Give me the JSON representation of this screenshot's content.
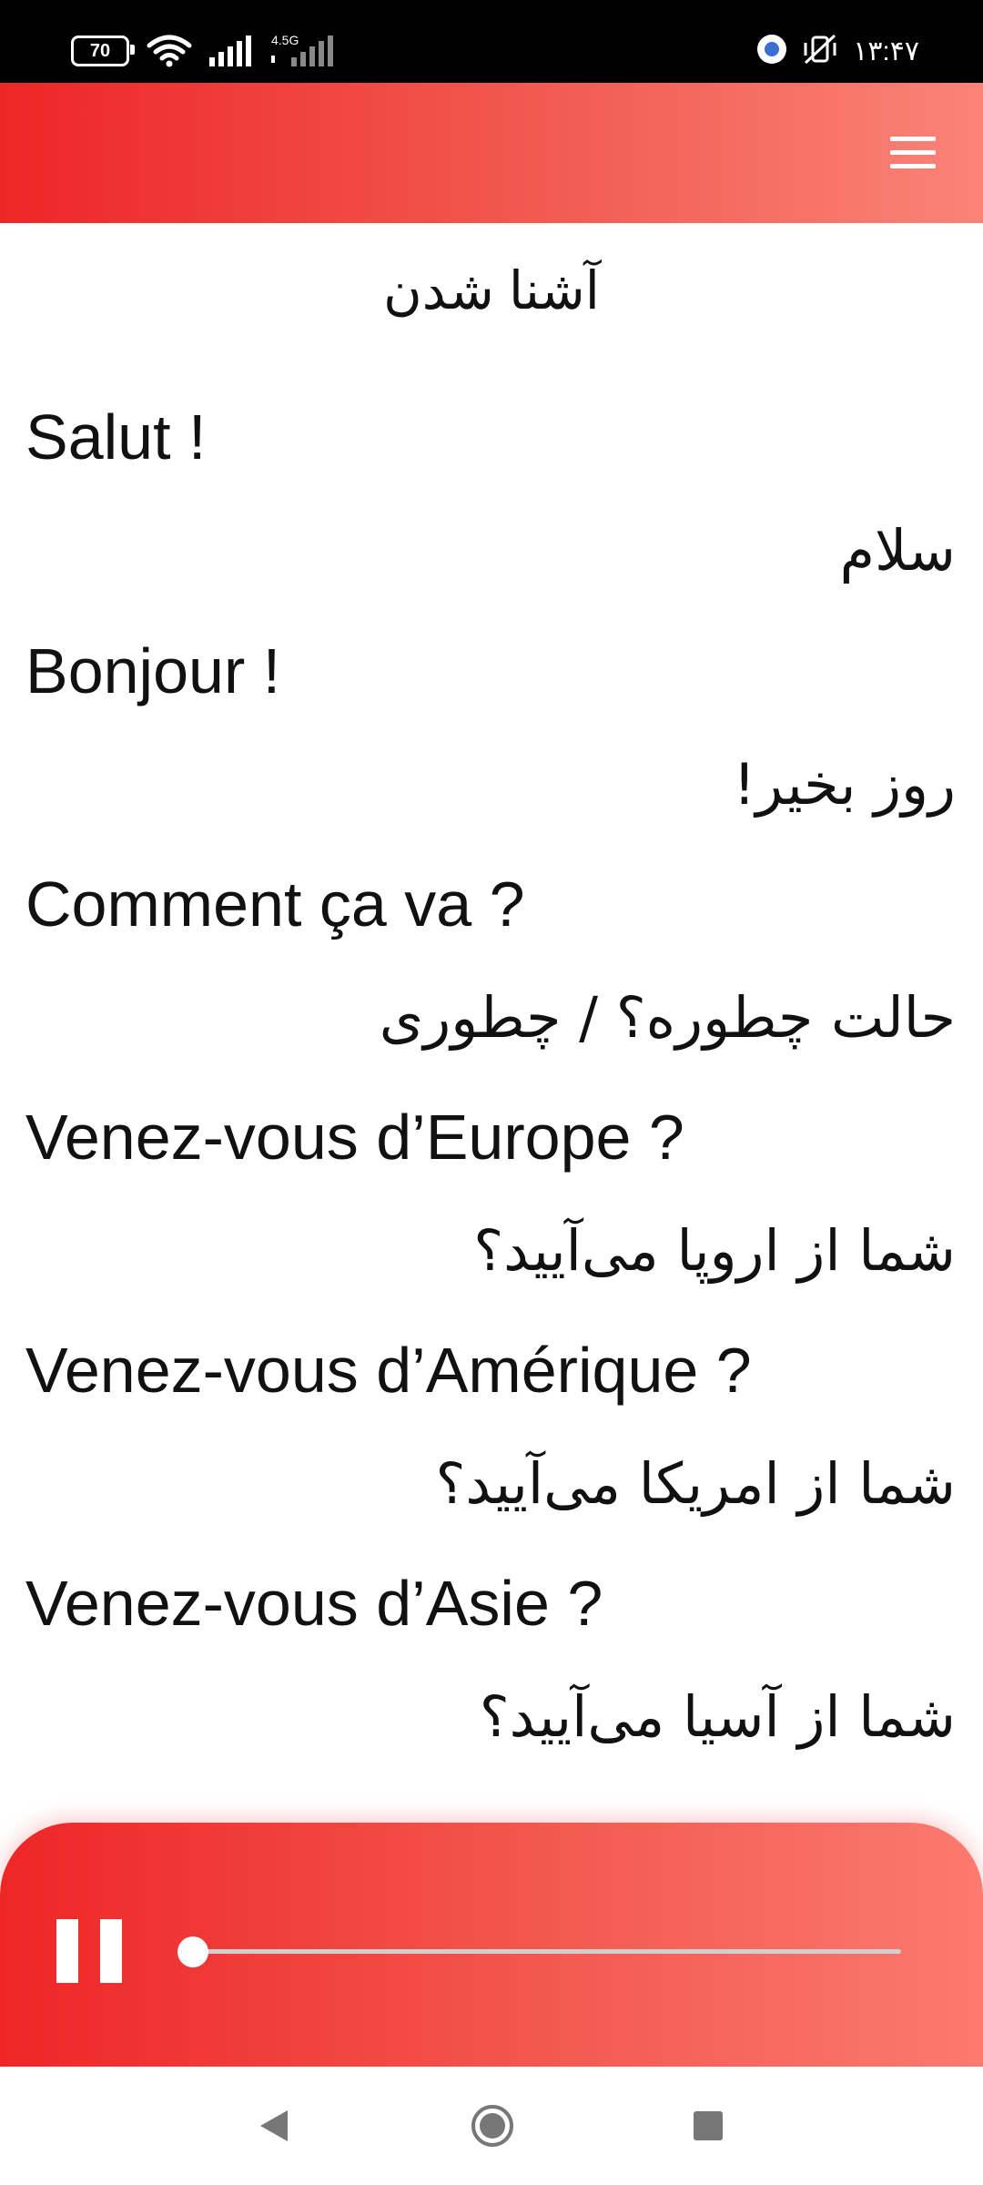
{
  "status_bar": {
    "battery": "70",
    "network_type": "4.5G",
    "time": "۱۳:۴۷"
  },
  "app_bar": {
    "menu_icon": "hamburger-menu-icon"
  },
  "lesson": {
    "title": "آشنا شدن",
    "phrases": [
      {
        "fr": "Salut !",
        "fa": "سلام"
      },
      {
        "fr": "Bonjour !",
        "fa": "روز بخیر!"
      },
      {
        "fr": "Comment ça va ?",
        "fa": "حالت چطوره؟ / چطوری"
      },
      {
        "fr": "Venez-vous d’Europe ?",
        "fa": "شما از اروپا می‌آیید؟"
      },
      {
        "fr": "Venez-vous d’Amérique ?",
        "fa": "شما از امریکا می‌آیید؟"
      },
      {
        "fr": "Venez-vous d’Asie ?",
        "fa": "شما از آسیا می‌آیید؟"
      }
    ]
  },
  "player": {
    "state": "playing",
    "pause_icon": "pause-icon",
    "progress": 0.0
  },
  "colors": {
    "accent_start": "#ee2626",
    "accent_end": "#fb8378"
  }
}
